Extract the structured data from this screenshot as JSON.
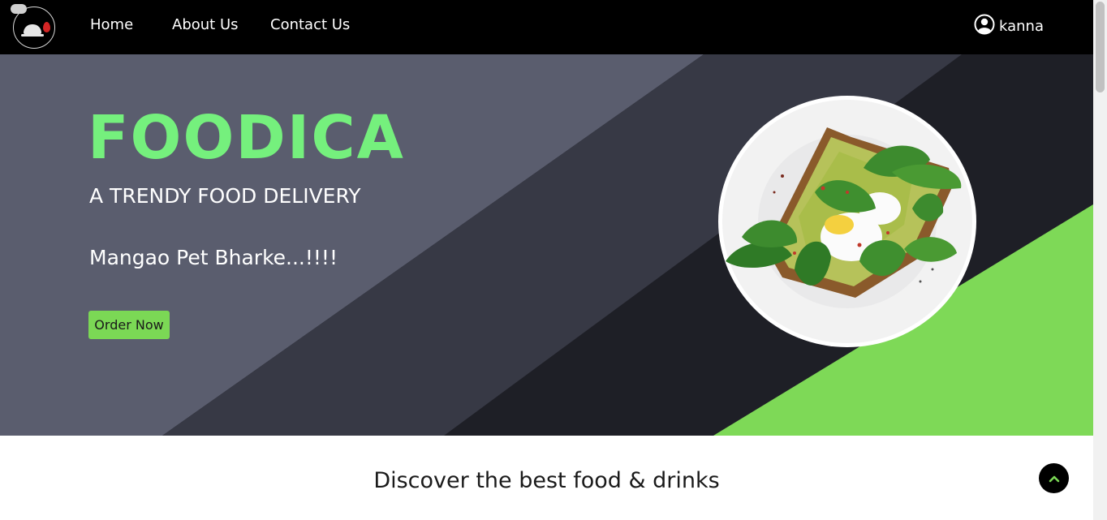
{
  "nav": {
    "links": [
      "Home",
      "About Us",
      "Contact Us"
    ],
    "user_name": "kanna"
  },
  "hero": {
    "brand": "FOODICA",
    "tagline": "A TRENDY FOOD DELIVERY",
    "slogan": "Mangao Pet Bharke...!!!!",
    "cta_label": "Order Now"
  },
  "section": {
    "heading": "Discover the best food & drinks"
  },
  "icons": {
    "logo": "restaurant-cloche-logo",
    "user": "user-circle-icon",
    "to_top": "chevron-up-icon",
    "hero_image": "avocado-toast-plate"
  },
  "colors": {
    "navbar": "#000000",
    "accent_green": "#7bd855",
    "brand_green": "#75f07d",
    "hero_slate": "#5a5d6e",
    "hero_dark": "#373945",
    "hero_darkest": "#1e1f26"
  }
}
